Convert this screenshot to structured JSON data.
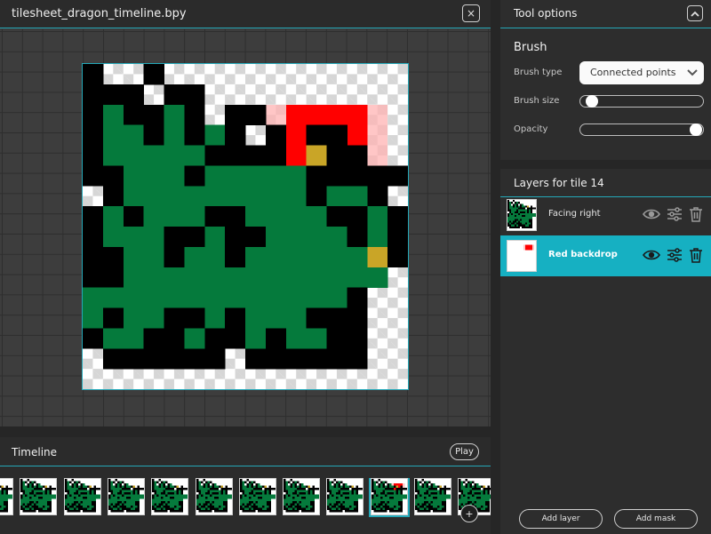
{
  "editor": {
    "file_title": "tilesheet_dragon_timeline.bpy",
    "close_label": "×",
    "close_icon": "close-icon"
  },
  "timeline": {
    "title": "Timeline",
    "play_label": "Play",
    "add_label": "+",
    "frame_count": 12,
    "selected_frame": 9
  },
  "tool_options": {
    "title": "Tool options",
    "collapse_icon": "chevron-up-icon",
    "section_title": "Brush",
    "brush_type_label": "Brush type",
    "brush_type_value": "Connected points",
    "brush_size_label": "Brush size",
    "brush_size_value": 0.05,
    "opacity_label": "Opacity",
    "opacity_value": 1.0
  },
  "layers": {
    "title": "Layers for tile 14",
    "items": [
      {
        "label": "Facing right",
        "active": false
      },
      {
        "label": "Red backdrop",
        "active": true
      }
    ],
    "add_layer_label": "Add layer",
    "add_mask_label": "Add mask"
  },
  "colors": {
    "accent": "#16b0c2",
    "dragon_green": "#057a3c",
    "outline_black": "#000000",
    "backdrop_red": "#ff0000",
    "eye_gold": "#c9a527"
  }
}
